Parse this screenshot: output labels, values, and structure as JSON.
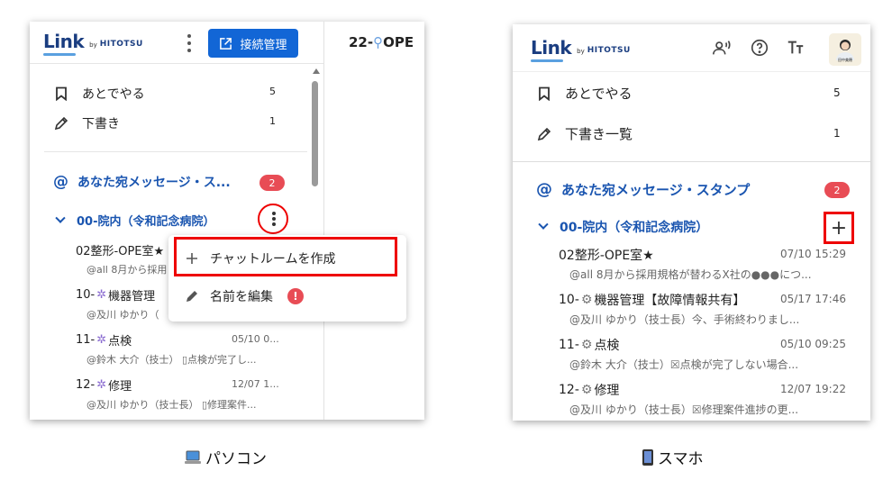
{
  "pc": {
    "logo": {
      "main": "Link",
      "by": "by",
      "brand": "HITOTSU"
    },
    "connect_button": "接続管理",
    "chat_title": "22-",
    "chat_title_suffix": "OPE",
    "todo": {
      "label": "あとでやる",
      "count": "5"
    },
    "draft": {
      "label": "下書き",
      "count": "1"
    },
    "mention": {
      "label": "あなた宛メッセージ・ス...",
      "count": "2"
    },
    "group": {
      "label": "00-院内（令和記念病院）"
    },
    "channels": [
      {
        "name": "02整形-OPE室★",
        "preview": "@all 8月から採用",
        "time": ""
      },
      {
        "name": "10-",
        "name2": "機器管理",
        "preview": "@及川 ゆかり（",
        "time": ""
      },
      {
        "name": "11-",
        "name2": "点検",
        "preview": "@鈴木 大介（技士）  ▯点検が完了し...",
        "time": "05/10 0..."
      },
      {
        "name": "12-",
        "name2": "修理",
        "preview": "@及川 ゆかり（技士長）  ▯修理案件...",
        "time": "12/07 1..."
      }
    ],
    "menu": {
      "create": "チャットルームを作成",
      "rename": "名前を編集",
      "warn": "!"
    }
  },
  "sp": {
    "logo": {
      "main": "Link",
      "by": "by",
      "brand": "HITOTSU"
    },
    "avatar_caption": "田中美穂",
    "todo": {
      "label": "あとでやる",
      "count": "5"
    },
    "draft": {
      "label": "下書き一覧",
      "count": "1"
    },
    "mention": {
      "label": "あなた宛メッセージ・スタンプ",
      "count": "2"
    },
    "group": {
      "label": "00-院内（令和記念病院）"
    },
    "plus": "+",
    "channels": [
      {
        "name": "02整形-OPE室★",
        "preview": "@all 8月から採用規格が替わるX社の●●●につ...",
        "time": "07/10 15:29"
      },
      {
        "name": "10-",
        "name2": "機器管理【故障情報共有】",
        "preview": "@及川 ゆかり（技士長）今、手術終わりまし...",
        "time": "05/17 17:46"
      },
      {
        "name": "11-",
        "name2": "点検",
        "preview": "@鈴木 大介（技士）☒点検が完了しない場合...",
        "time": "05/10 09:25"
      },
      {
        "name": "12-",
        "name2": "修理",
        "preview": "@及川 ゆかり（技士長）☒修理案件進捗の更...",
        "time": "12/07 19:22"
      }
    ]
  },
  "captions": {
    "pc": "パソコン",
    "sp": "スマホ"
  },
  "colors": {
    "accent": "#1266d6",
    "brand": "#1a3d80",
    "highlight": "#e00000",
    "badge": "#e84c55"
  }
}
